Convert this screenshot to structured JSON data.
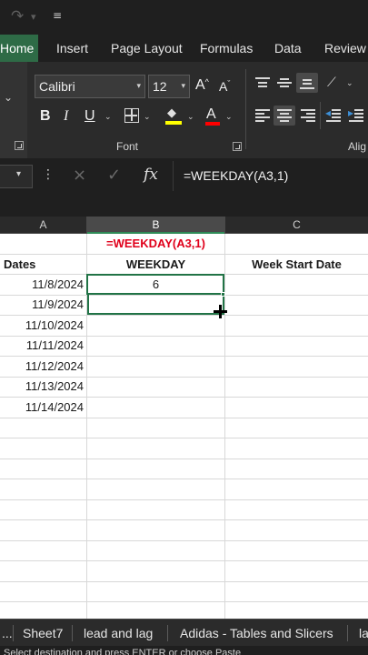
{
  "quick_access": {
    "redo_icon": "redo-icon",
    "redo_dropdown_icon": "chevron-down-icon",
    "customize_icon": "customize-qat-icon"
  },
  "ribbon_tabs": [
    {
      "label": "Home",
      "active": true
    },
    {
      "label": "Insert"
    },
    {
      "label": "Page Layout"
    },
    {
      "label": "Formulas"
    },
    {
      "label": "Data"
    },
    {
      "label": "Review"
    }
  ],
  "font_group": {
    "font_name": "Calibri",
    "font_size": "12",
    "grow_label": "A",
    "shrink_label": "A",
    "bold_label": "B",
    "italic_label": "I",
    "underline_label": "U",
    "color_label": "A",
    "group_label": "Font",
    "highlight_color": "#ffff00",
    "font_color": "#ff0000"
  },
  "alignment_group": {
    "group_label_partial": "Alig"
  },
  "formula_bar": {
    "cancel_icon": "×",
    "enter_icon": "✓",
    "fx_label": "fx",
    "formula": "=WEEKDAY(A3,1)"
  },
  "columns": [
    {
      "label": "A"
    },
    {
      "label": "B",
      "selected": true
    },
    {
      "label": "C"
    }
  ],
  "sheet": {
    "annotation": "=WEEKDAY(A3,1)",
    "header_dates": "Dates",
    "header_weekday": "WEEKDAY",
    "header_week_start": "Week Start Date",
    "dates": [
      "11/8/2024",
      "11/9/2024",
      "11/10/2024",
      "11/11/2024",
      "11/12/2024",
      "11/13/2024",
      "11/14/2024"
    ],
    "weekday_values": [
      "6"
    ]
  },
  "sheet_tabs": [
    {
      "label": "..."
    },
    {
      "label": "Sheet7"
    },
    {
      "label": "lead and lag"
    },
    {
      "label": "Adidas - Tables and Slicers"
    },
    {
      "label": "la"
    }
  ],
  "status": {
    "text": "Select destination and press ENTER or choose Paste"
  },
  "colors": {
    "accent": "#217346",
    "annotation": "#e0001b",
    "chrome": "#1f1f1f"
  }
}
